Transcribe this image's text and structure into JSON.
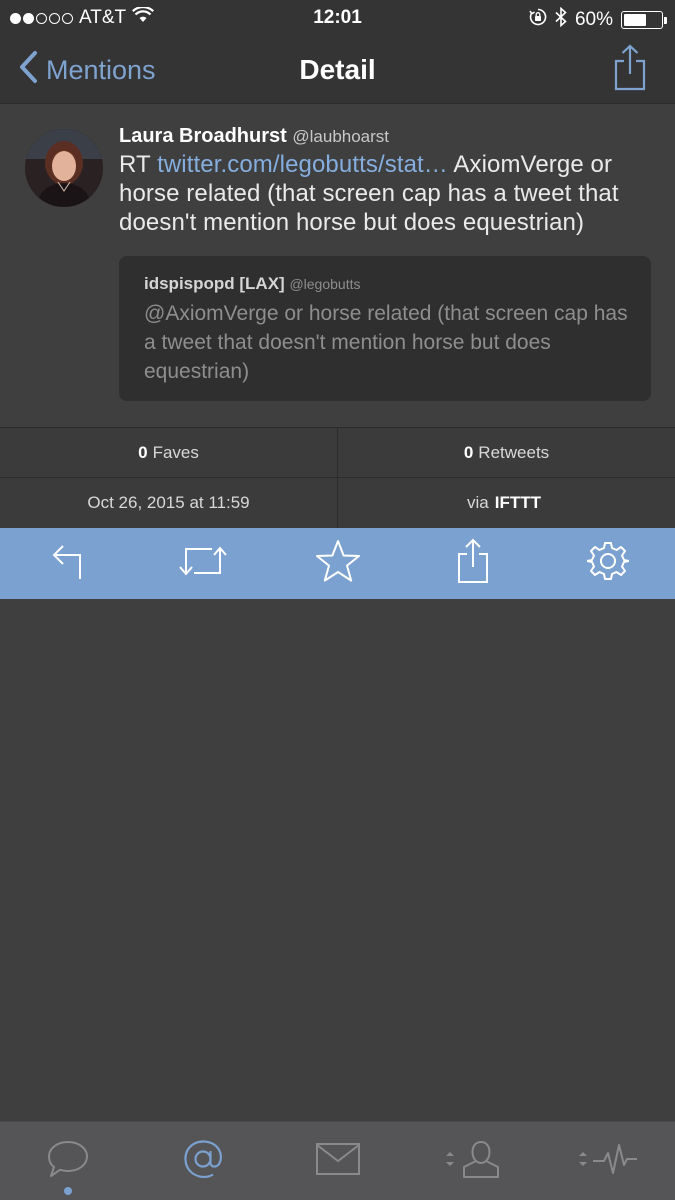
{
  "status_bar": {
    "carrier": "AT&T",
    "time": "12:01",
    "battery_percent": "60%",
    "battery_level": 0.6,
    "signal_bars_filled": 2,
    "signal_bars_total": 5
  },
  "nav": {
    "back_label": "Mentions",
    "title": "Detail",
    "share_icon": "share-icon"
  },
  "tweet": {
    "author_name": "Laura Broadhurst",
    "author_handle": "@laubhoarst",
    "text_prefix": "RT ",
    "link_text": "twitter.com/legobutts/stat…",
    "text_suffix": " AxiomVerge or horse related (that screen cap has a tweet that doesn't mention horse but does equestrian)",
    "quote": {
      "author_name": "idspispopd [LAX]",
      "author_handle": "@legobutts",
      "text": "@AxiomVerge or horse related (that screen cap has a tweet that doesn't mention horse but does equestrian)"
    }
  },
  "stats": {
    "faves_count": "0",
    "faves_label": "Faves",
    "retweets_count": "0",
    "retweets_label": "Retweets",
    "date": "Oct 26, 2015 at 11:59",
    "via_label": "via",
    "source": "IFTTT"
  },
  "actions": [
    "reply-icon",
    "retweet-icon",
    "star-icon",
    "share-icon",
    "gear-icon"
  ],
  "tabs": [
    {
      "name": "timeline-tab",
      "icon": "speech-bubble-icon",
      "active": true
    },
    {
      "name": "mentions-tab",
      "icon": "at-sign-icon",
      "active": false
    },
    {
      "name": "messages-tab",
      "icon": "envelope-icon",
      "active": false
    },
    {
      "name": "profile-tab",
      "icon": "person-icon",
      "active": false
    },
    {
      "name": "activity-tab",
      "icon": "activity-icon",
      "active": false
    }
  ],
  "colors": {
    "accent": "#7aa1cf",
    "link": "#85aede",
    "background": "#3f3f40",
    "tab_bar": "#555557"
  }
}
